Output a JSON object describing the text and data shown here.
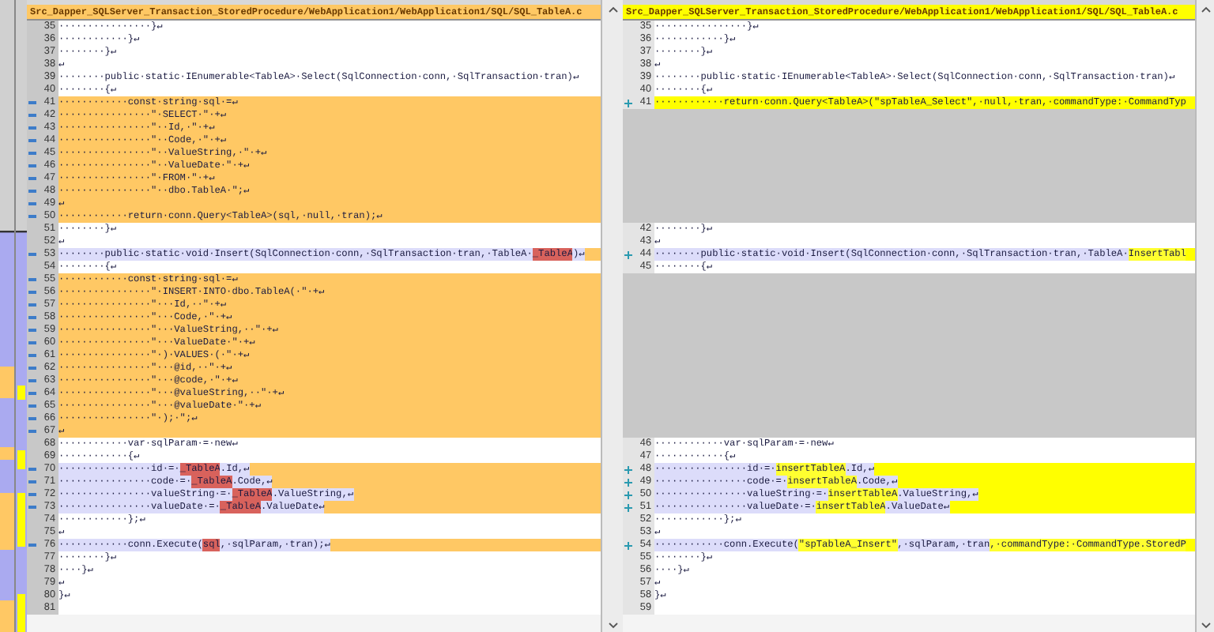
{
  "left_pane": {
    "kind": "original",
    "header": "Src_Dapper_SQLServer_Transaction_StoredProcedure/WebApplication1/WebApplication1/SQL/SQL_TableA.c",
    "rows": [
      {
        "number": "35",
        "kind": "same",
        "text": "················}↵"
      },
      {
        "number": "36",
        "kind": "same",
        "text": "············}↵"
      },
      {
        "number": "37",
        "kind": "same",
        "text": "········}↵"
      },
      {
        "number": "38",
        "kind": "same",
        "text": "↵"
      },
      {
        "number": "39",
        "kind": "same",
        "text": "········public·static·IEnumerable<TableA>·Select(SqlConnection·conn,·SqlTransaction·tran)↵"
      },
      {
        "number": "40",
        "kind": "same",
        "text": "········{↵"
      },
      {
        "number": "41",
        "kind": "changed",
        "text": "············const·string·sql·=↵"
      },
      {
        "number": "42",
        "kind": "changed",
        "text": "················\"·SELECT·\"·+↵"
      },
      {
        "number": "43",
        "kind": "changed",
        "text": "················\"··Id,·\"·+↵"
      },
      {
        "number": "44",
        "kind": "changed",
        "text": "················\"··Code,·\"·+↵"
      },
      {
        "number": "45",
        "kind": "changed",
        "text": "················\"··ValueString,·\"·+↵"
      },
      {
        "number": "46",
        "kind": "changed",
        "text": "················\"··ValueDate·\"·+↵"
      },
      {
        "number": "47",
        "kind": "changed",
        "text": "················\"·FROM·\"·+↵"
      },
      {
        "number": "48",
        "kind": "changed",
        "text": "················\"··dbo.TableA·\";↵"
      },
      {
        "number": "49",
        "kind": "changed",
        "text": "↵"
      },
      {
        "number": "50",
        "kind": "changed",
        "text": "············return·conn.Query<TableA>(sql,·null,·tran);↵"
      },
      {
        "number": "51",
        "kind": "same",
        "text": "········}↵"
      },
      {
        "number": "52",
        "kind": "same",
        "text": "↵"
      },
      {
        "number": "53",
        "kind": "modified",
        "segments": [
          {
            "text": "········public·static·void·Insert(SqlConnection·conn,·SqlTransaction·tran,·TableA·",
            "changed": false
          },
          {
            "text": "_TableA",
            "changed": true
          },
          {
            "text": ")↵",
            "changed": false
          }
        ]
      },
      {
        "number": "54",
        "kind": "same",
        "text": "········{↵"
      },
      {
        "number": "55",
        "kind": "changed",
        "text": "············const·string·sql·=↵"
      },
      {
        "number": "56",
        "kind": "changed",
        "text": "················\"·INSERT·INTO·dbo.TableA(·\"·+↵"
      },
      {
        "number": "57",
        "kind": "changed",
        "text": "················\"···Id,··\"·+↵"
      },
      {
        "number": "58",
        "kind": "changed",
        "text": "················\"···Code,·\"·+↵"
      },
      {
        "number": "59",
        "kind": "changed",
        "text": "················\"···ValueString,··\"·+↵"
      },
      {
        "number": "60",
        "kind": "changed",
        "text": "················\"···ValueDate·\"·+↵"
      },
      {
        "number": "61",
        "kind": "changed",
        "text": "················\"·)·VALUES·(·\"·+↵"
      },
      {
        "number": "62",
        "kind": "changed",
        "text": "················\"···@id,··\"·+↵"
      },
      {
        "number": "63",
        "kind": "changed",
        "text": "················\"···@code,·\"·+↵"
      },
      {
        "number": "64",
        "kind": "changed",
        "text": "················\"···@valueString,··\"·+↵"
      },
      {
        "number": "65",
        "kind": "changed",
        "text": "················\"···@valueDate·\"·+↵"
      },
      {
        "number": "66",
        "kind": "changed",
        "text": "················\"·);·\";↵"
      },
      {
        "number": "67",
        "kind": "changed",
        "text": "↵"
      },
      {
        "number": "68",
        "kind": "same",
        "text": "············var·sqlParam·=·new↵"
      },
      {
        "number": "69",
        "kind": "same",
        "text": "············{↵"
      },
      {
        "number": "70",
        "kind": "modified",
        "segments": [
          {
            "text": "················id·=·",
            "changed": false
          },
          {
            "text": "_TableA",
            "changed": true
          },
          {
            "text": ".Id,↵",
            "changed": false
          }
        ]
      },
      {
        "number": "71",
        "kind": "modified",
        "segments": [
          {
            "text": "················code·=·",
            "changed": false
          },
          {
            "text": "_TableA",
            "changed": true
          },
          {
            "text": ".Code,↵",
            "changed": false
          }
        ]
      },
      {
        "number": "72",
        "kind": "modified",
        "segments": [
          {
            "text": "················valueString·=·",
            "changed": false
          },
          {
            "text": "_TableA",
            "changed": true
          },
          {
            "text": ".ValueString,↵",
            "changed": false
          }
        ]
      },
      {
        "number": "73",
        "kind": "modified",
        "segments": [
          {
            "text": "················valueDate·=·",
            "changed": false
          },
          {
            "text": "_TableA",
            "changed": true
          },
          {
            "text": ".ValueDate↵",
            "changed": false
          }
        ]
      },
      {
        "number": "74",
        "kind": "same",
        "text": "············};↵"
      },
      {
        "number": "75",
        "kind": "same",
        "text": "↵"
      },
      {
        "number": "76",
        "kind": "modified",
        "segments": [
          {
            "text": "············conn.Execute(",
            "changed": false
          },
          {
            "text": "sql",
            "changed": true
          },
          {
            "text": ",·sqlParam,·tran);↵",
            "changed": false
          }
        ]
      },
      {
        "number": "77",
        "kind": "same",
        "text": "········}↵"
      },
      {
        "number": "78",
        "kind": "same",
        "text": "····}↵"
      },
      {
        "number": "79",
        "kind": "same",
        "text": "↵"
      },
      {
        "number": "80",
        "kind": "same",
        "text": "}↵"
      },
      {
        "number": "81",
        "kind": "same"
      }
    ]
  },
  "right_pane": {
    "kind": "revised",
    "header": "Src_Dapper_SQLServer_Transaction_StoredProcedure/WebApplication1/WebApplication1/SQL/SQL_TableA.c",
    "rows": [
      {
        "number": "35",
        "kind": "same",
        "text": "················}↵"
      },
      {
        "number": "36",
        "kind": "same",
        "text": "············}↵"
      },
      {
        "number": "37",
        "kind": "same",
        "text": "········}↵"
      },
      {
        "number": "38",
        "kind": "same",
        "text": "↵"
      },
      {
        "number": "39",
        "kind": "same",
        "text": "········public·static·IEnumerable<TableA>·Select(SqlConnection·conn,·SqlTransaction·tran)↵"
      },
      {
        "number": "40",
        "kind": "same",
        "text": "········{↵"
      },
      {
        "number": "41",
        "kind": "changed",
        "text": "············return·conn.Query<TableA>(\"spTableA_Select\",·null,·tran,·commandType:·CommandTyp"
      },
      {
        "kind": "filler"
      },
      {
        "kind": "filler"
      },
      {
        "kind": "filler"
      },
      {
        "kind": "filler"
      },
      {
        "kind": "filler"
      },
      {
        "kind": "filler"
      },
      {
        "kind": "filler"
      },
      {
        "kind": "filler"
      },
      {
        "kind": "filler"
      },
      {
        "number": "42",
        "kind": "same",
        "text": "········}↵"
      },
      {
        "number": "43",
        "kind": "same",
        "text": "↵"
      },
      {
        "number": "44",
        "kind": "modified",
        "segments": [
          {
            "text": "········public·static·void·Insert(SqlConnection·conn,·SqlTransaction·tran,·TableA·",
            "changed": false
          },
          {
            "text": "InsertTabl",
            "changed": true
          }
        ]
      },
      {
        "number": "45",
        "kind": "same",
        "text": "········{↵"
      },
      {
        "kind": "filler"
      },
      {
        "kind": "filler"
      },
      {
        "kind": "filler"
      },
      {
        "kind": "filler"
      },
      {
        "kind": "filler"
      },
      {
        "kind": "filler"
      },
      {
        "kind": "filler"
      },
      {
        "kind": "filler"
      },
      {
        "kind": "filler"
      },
      {
        "kind": "filler"
      },
      {
        "kind": "filler"
      },
      {
        "kind": "filler"
      },
      {
        "kind": "filler"
      },
      {
        "number": "46",
        "kind": "same",
        "text": "············var·sqlParam·=·new↵"
      },
      {
        "number": "47",
        "kind": "same",
        "text": "············{↵"
      },
      {
        "number": "48",
        "kind": "modified",
        "segments": [
          {
            "text": "················id·=·",
            "changed": false
          },
          {
            "text": "insertTableA",
            "changed": true
          },
          {
            "text": ".Id,↵",
            "changed": false
          }
        ]
      },
      {
        "number": "49",
        "kind": "modified",
        "segments": [
          {
            "text": "················code·=·",
            "changed": false
          },
          {
            "text": "insertTableA",
            "changed": true
          },
          {
            "text": ".Code,↵",
            "changed": false
          }
        ]
      },
      {
        "number": "50",
        "kind": "modified",
        "segments": [
          {
            "text": "················valueString·=·",
            "changed": false
          },
          {
            "text": "insertTableA",
            "changed": true
          },
          {
            "text": ".ValueString,↵",
            "changed": false
          }
        ]
      },
      {
        "number": "51",
        "kind": "modified",
        "segments": [
          {
            "text": "················valueDate·=·",
            "changed": false
          },
          {
            "text": "insertTableA",
            "changed": true
          },
          {
            "text": ".ValueDate↵",
            "changed": false
          }
        ]
      },
      {
        "number": "52",
        "kind": "same",
        "text": "············};↵"
      },
      {
        "number": "53",
        "kind": "same",
        "text": "↵"
      },
      {
        "number": "54",
        "kind": "modified",
        "segments": [
          {
            "text": "············conn.Execute(",
            "changed": false
          },
          {
            "text": "\"spTableA_Insert\"",
            "changed": true
          },
          {
            "text": ",·sqlParam,·tran",
            "changed": false
          },
          {
            "text": ",·commandType:·CommandType.StoredP",
            "changed": true
          }
        ]
      },
      {
        "number": "55",
        "kind": "same",
        "text": "········}↵"
      },
      {
        "number": "56",
        "kind": "same",
        "text": "····}↵"
      },
      {
        "number": "57",
        "kind": "same",
        "text": "↵"
      },
      {
        "number": "58",
        "kind": "same",
        "text": "}↵"
      },
      {
        "number": "59",
        "kind": "same"
      }
    ]
  }
}
